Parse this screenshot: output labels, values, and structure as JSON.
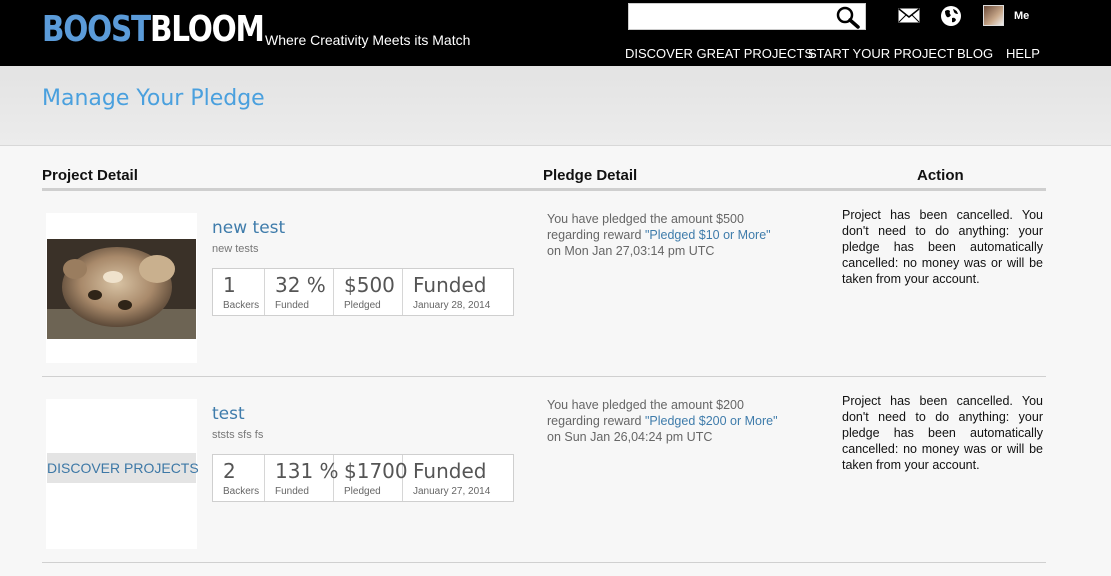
{
  "header": {
    "logo_part1": "BOOST",
    "logo_part2": "BLOOM",
    "tagline": "Where Creativity Meets its Match",
    "search_placeholder": "",
    "user_label": "Me",
    "nav": {
      "discover": "DISCOVER GREAT PROJECTS",
      "start": "START YOUR PROJECT",
      "blog": "BLOG",
      "help": "HELP"
    }
  },
  "page_title": "Manage Your Pledge",
  "columns": {
    "project": "Project Detail",
    "pledge": "Pledge Detail",
    "action": "Action"
  },
  "rows": [
    {
      "name": "new test",
      "description": "new tests",
      "backers": "1",
      "backers_label": "Backers",
      "funded_pct": "32 %",
      "funded_label": "Funded",
      "pledged": "$500",
      "pledged_label": "Pledged",
      "status": "Funded",
      "status_date": "January 28, 2014",
      "pledge_line1": "You have pledged the amount $500",
      "pledge_line2": "regarding reward ",
      "pledge_reward": "\"Pledged $10 or More\"",
      "pledge_date": "on Mon Jan 27,03:14 pm UTC",
      "action": "Project has been cancelled. You don't need to do anything: your pledge has been automatically cancelled: no money was or will be taken from your account."
    },
    {
      "name": "test",
      "description": "ststs sfs fs",
      "thumb_banner": "DISCOVER PROJECTS",
      "backers": "2",
      "backers_label": "Backers",
      "funded_pct": "131 %",
      "funded_label": "Funded",
      "pledged": "$1700",
      "pledged_label": "Pledged",
      "status": "Funded",
      "status_date": "January 27, 2014",
      "pledge_line1": "You have pledged the amount $200",
      "pledge_line2": "regarding reward ",
      "pledge_reward": "\"Pledged $200 or More\"",
      "pledge_date": "on Sun Jan 26,04:24 pm UTC",
      "action": "Project has been cancelled. You don't need to do anything: your pledge has been automatically cancelled: no money was or will be taken from your account."
    }
  ],
  "icons": {
    "search": "search-icon",
    "mail": "mail-icon",
    "globe": "globe-icon"
  },
  "colors": {
    "accent": "#4aa0de",
    "link": "#3f7cab",
    "header_bg": "#000000"
  }
}
